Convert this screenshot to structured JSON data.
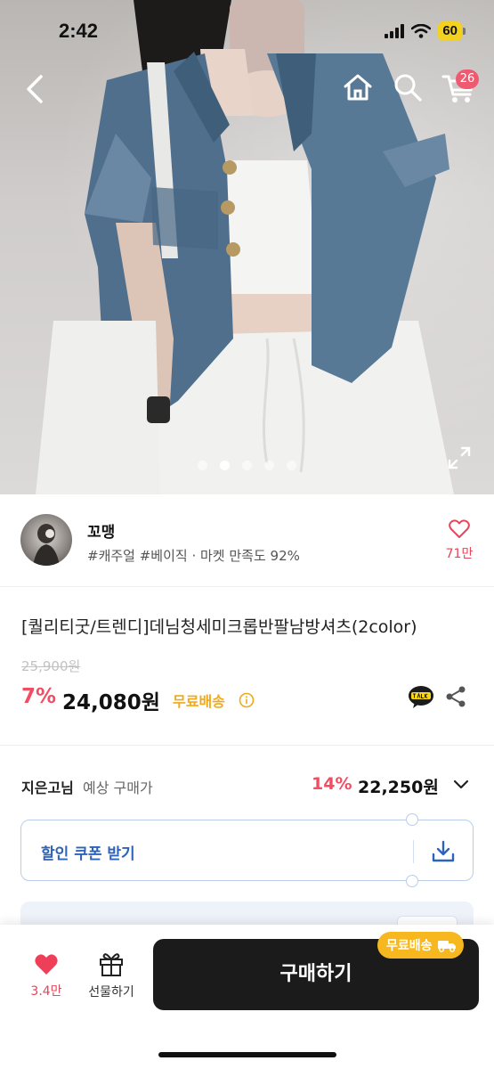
{
  "status_bar": {
    "time": "2:42",
    "battery": "60",
    "icons": [
      "signal-icon",
      "wifi-icon",
      "battery-icon"
    ]
  },
  "top_nav": {
    "cart_badge": "26",
    "icons": [
      "back-arrow-icon",
      "home-icon",
      "search-icon",
      "cart-icon"
    ]
  },
  "gallery": {
    "image_count": 5,
    "active_index": 1
  },
  "seller": {
    "name": "꼬맹",
    "meta": "#캐주얼 #베이직 · 마켓 만족도 92%",
    "like_count": "71만"
  },
  "product": {
    "title": "[퀄리티굿/트렌디]데님청세미크롭반팔남방셔츠(2color)",
    "original_price": "25,900원",
    "discount": "7%",
    "price": "24,080원",
    "shipping": "무료배송"
  },
  "expected_price": {
    "user_name": "지은고님",
    "label": "예상 구매가",
    "discount": "14%",
    "price": "22,250원"
  },
  "coupon": {
    "label": "할인 쿠폰 받기"
  },
  "bottom_bar": {
    "wish_count": "3.4만",
    "gift_label": "선물하기",
    "buy_label": "구매하기",
    "ship_tag": "무료배송"
  },
  "colors": {
    "accent_red": "#ef4e63",
    "shipping_yellow": "#f0a91b",
    "coupon_blue": "#2d63b8",
    "buy_button": "#1b1b1b"
  }
}
